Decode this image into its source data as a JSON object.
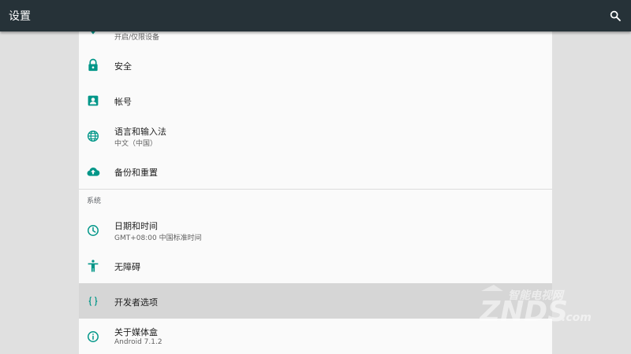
{
  "app": {
    "title": "设置"
  },
  "colors": {
    "toolbar": "#263238",
    "accent": "#009688",
    "panel": "#fafafa",
    "highlight": "#d6d6d6"
  },
  "settings": {
    "partial": {
      "summary": "开启/仅限设备",
      "icon": "location-icon"
    },
    "security": {
      "title": "安全",
      "icon": "lock-icon"
    },
    "accounts": {
      "title": "帐号",
      "icon": "account-box-icon"
    },
    "language": {
      "title": "语言和输入法",
      "summary": "中文（中国）",
      "icon": "globe-icon"
    },
    "backup": {
      "title": "备份和重置",
      "icon": "cloud-upload-icon"
    },
    "system_header": "系统",
    "datetime": {
      "title": "日期和时间",
      "summary": "GMT+08:00 中国标准时间",
      "icon": "clock-icon"
    },
    "accessibility": {
      "title": "无障碍",
      "icon": "accessibility-icon"
    },
    "developer": {
      "title": "开发者选项",
      "icon": "code-braces-icon"
    },
    "about": {
      "title": "关于媒体盒",
      "summary": "Android 7.1.2",
      "icon": "info-icon"
    }
  },
  "watermark": {
    "text_top": "智能电视网",
    "text_main": "ZNDS",
    "text_suffix": ".com"
  }
}
